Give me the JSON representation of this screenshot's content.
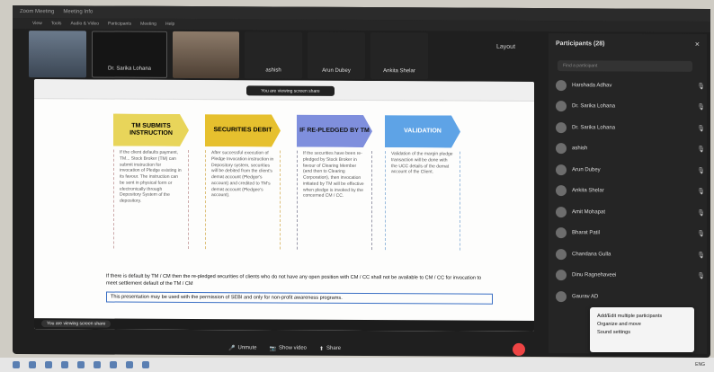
{
  "window": {
    "title": "Zoom Meeting",
    "title_items": [
      "Zoom Meeting",
      "Meeting Info"
    ]
  },
  "menu": [
    "View",
    "Tools",
    "Audio & Video",
    "Participants",
    "Meeting",
    "Help"
  ],
  "video_strip": [
    {
      "label": ""
    },
    {
      "label": "Dr. Sarika Lohana"
    },
    {
      "label": ""
    },
    {
      "label": "ashish"
    },
    {
      "label": "Arun Dubey"
    },
    {
      "label": "Ankita Shelar"
    }
  ],
  "layout_label": "Layout",
  "share": {
    "toolbar_title": "You are viewing screen share",
    "flow": [
      {
        "header": "TM SUBMITS INSTRUCTION",
        "body": "If the client defaults payment, TM... Stock Broker (TM) can submit instruction for invocation of Pledge existing in its favour. The instruction can be sent in physical form or electronically through Depository System of the depository."
      },
      {
        "header": "SECURITIES DEBIT",
        "body": "After successful execution of Pledge Invocation instruction in Depository system, securities will be debited from the client's demat account (Pledgor's account) and credited to TM's demat account (Pledgee's account)."
      },
      {
        "header": "IF RE-PLEDGED BY TM",
        "body": "If the securities have been re-pledged by Stock Broker in favour of Clearing Member (and then to Clearing Corporation), then invocation initiated by TM will be effective when pledge is invoked by the concerned CM / CC."
      },
      {
        "header": "VALIDATION",
        "body": "Validation of the margin pledge transaction will be done with the UCC details of the demat account of the Client."
      }
    ],
    "note1": "If there is default by TM / CM then the re-pledged securities of clients who do not have any open position with CM / CC shall not be available to CM / CC for invocation to meet settlement default of the TM / CM",
    "note2": "This presentation may be used with the permission of SEBI and only for non-profit awareness programs.",
    "bottom_pill": "You are viewing screen share"
  },
  "participants": {
    "title": "Participants (28)",
    "search_placeholder": "Find a participant",
    "list": [
      "Harshada Adhav",
      "Dr. Sarika Lohana",
      "Dr. Sarika Lohana",
      "ashish",
      "Arun Dubey",
      "Ankita Shelar",
      "Amit Mohapat",
      "Bharat Patil",
      "Chandana Gulla",
      "Dinu Ragnehaveei",
      "Gaurav AD"
    ]
  },
  "popup": [
    "Add/Edit multiple participants",
    "Organize and move",
    "Sound settings"
  ],
  "controls": {
    "unmute": "Unmute",
    "show_video": "Show video",
    "share": "Share"
  },
  "taskbar": {
    "tray": "ENG"
  }
}
